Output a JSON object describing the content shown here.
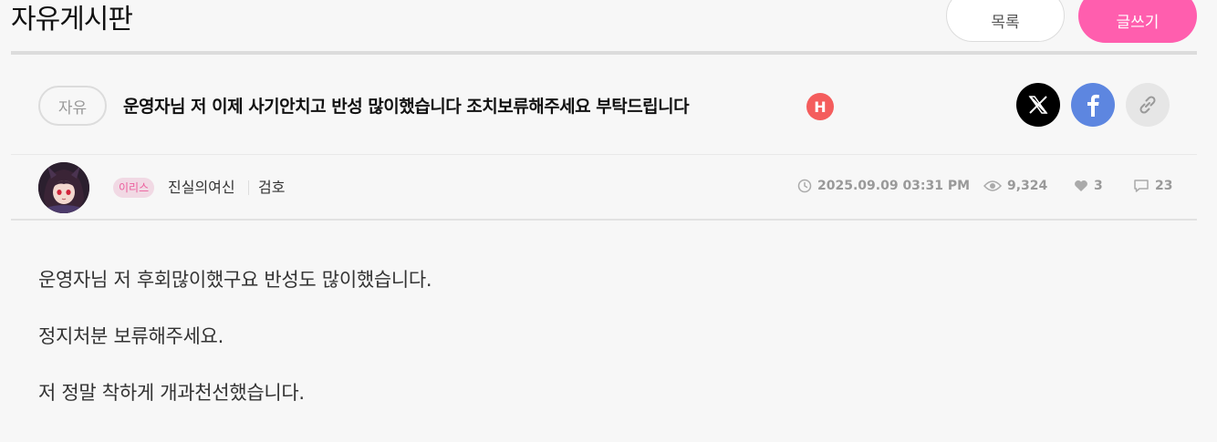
{
  "board": {
    "title": "자유게시판"
  },
  "buttons": {
    "list_label": "목록",
    "write_label": "글쓰기"
  },
  "post": {
    "category": "자유",
    "title": "운영자님 저 이제 사기안치고 반성 많이했습니다 조치보류해주세요 부탁드립니다",
    "hot_badge": "H",
    "author_tag": "이리스",
    "author_name": "진실의여신",
    "author_rank": "검호",
    "datetime": "2025.09.09 03:31 PM",
    "views": "9,324",
    "likes": "3",
    "comments": "23",
    "body": [
      "운영자님 저 후회많이했구요 반성도 많이했습니다.",
      "정지처분 보류해주세요.",
      "저 정말 착하게 개과천선했습니다."
    ]
  },
  "share": {
    "icons": [
      "x-icon",
      "facebook-icon",
      "link-icon"
    ]
  },
  "colors": {
    "accent": "#ff5eae",
    "hot": "#f45d5d",
    "facebook": "#5d86e0",
    "tag_bg": "#f1d9e4",
    "tag_text": "#ec5d9c"
  }
}
